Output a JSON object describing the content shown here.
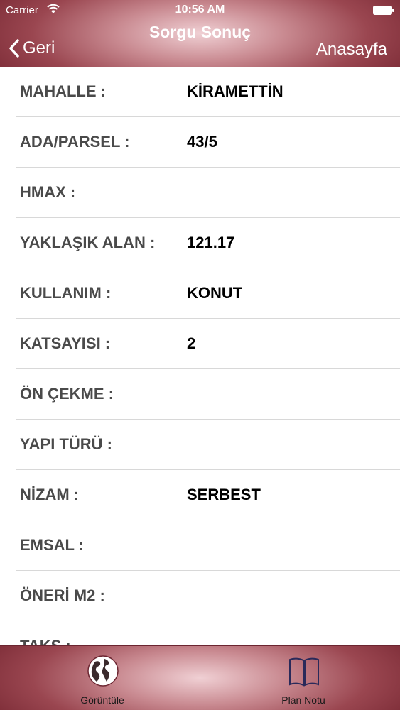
{
  "status_bar": {
    "carrier": "Carrier",
    "time": "10:56 AM"
  },
  "nav": {
    "title": "Sorgu Sonuç",
    "back_label": "Geri",
    "home_label": "Anasayfa"
  },
  "rows": [
    {
      "label": "MAHALLE :",
      "value": "KİRAMETTİN"
    },
    {
      "label": "ADA/PARSEL :",
      "value": "43/5"
    },
    {
      "label": "HMAX :",
      "value": ""
    },
    {
      "label": "YAKLAŞIK ALAN :",
      "value": "121.17"
    },
    {
      "label": "KULLANIM :",
      "value": "KONUT"
    },
    {
      "label": "KATSAYISI :",
      "value": "2"
    },
    {
      "label": "ÖN ÇEKME :",
      "value": ""
    },
    {
      "label": "YAPI TÜRÜ :",
      "value": ""
    },
    {
      "label": "NİZAM :",
      "value": "SERBEST"
    },
    {
      "label": "EMSAL :",
      "value": ""
    },
    {
      "label": "ÖNERİ M2 :",
      "value": ""
    },
    {
      "label": "TAKS :",
      "value": ""
    }
  ],
  "tabs": [
    {
      "label": "Görüntüle",
      "icon": "globe-icon"
    },
    {
      "label": "Plan Notu",
      "icon": "book-icon"
    }
  ],
  "colors": {
    "bar_dark": "#7a2a35",
    "bar_light": "#f0d0d4",
    "label_text": "#4a4a4a",
    "value_text": "#000000",
    "separator": "#d8d8d8"
  }
}
